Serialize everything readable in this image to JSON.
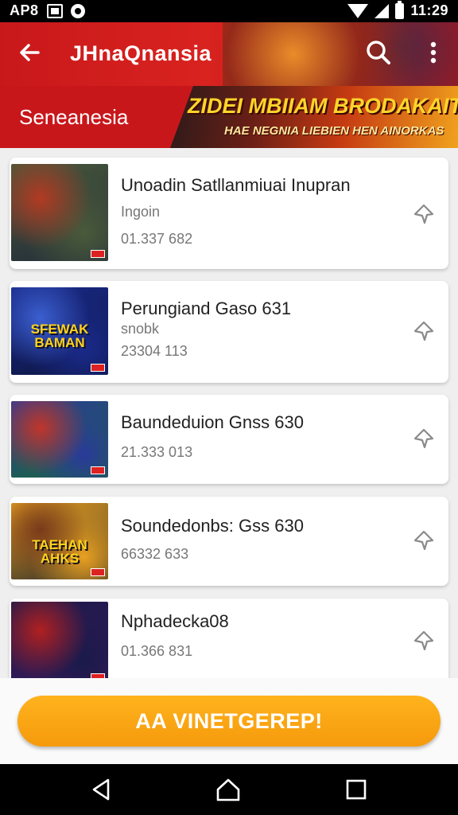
{
  "status_bar": {
    "carrier": "AP8",
    "time": "11:29"
  },
  "app_bar": {
    "title": "JHnaQnansia"
  },
  "banner": {
    "subtitle": "Seneanesia",
    "headline": "ZIDEI MBIIAM BRODAKAIT",
    "tagline": "HAE NEGNIA LIEBIEN HEN AINORKAS"
  },
  "items": [
    {
      "title": "Unoadin Satllanmiuai Inupran",
      "subtitle": "Ingoin",
      "stat": "01.337 682",
      "thumb_colors": [
        "#4a5a3a",
        "#b23a22",
        "#1f2a3a"
      ],
      "thumb_text": ""
    },
    {
      "title": "Perungiand Gaso 631",
      "subtitle": "snobk",
      "stat": "23304 113",
      "thumb_colors": [
        "#1a2a8a",
        "#3b5fd0",
        "#0d1540"
      ],
      "thumb_text": "SFEWAK BAMAN"
    },
    {
      "title": "Baundeduion Gnss 630",
      "subtitle": "",
      "stat": "21.333 013",
      "thumb_colors": [
        "#2a3a9a",
        "#c0352a",
        "#1a6a3a"
      ],
      "thumb_text": ""
    },
    {
      "title": "Soundedonbs: Gss 630",
      "subtitle": "",
      "stat": "66332 633",
      "thumb_colors": [
        "#e8a020",
        "#7a3a1a",
        "#2a2a2a"
      ],
      "thumb_text": "TAEHAN AHKS"
    },
    {
      "title": "Nphadecka08",
      "subtitle": "",
      "stat": "01.366 831",
      "thumb_colors": [
        "#1a1a4a",
        "#b02020",
        "#3a1a5a"
      ],
      "thumb_text": ""
    }
  ],
  "footer": {
    "cta_label": "AA VINETGEREP!"
  },
  "colors": {
    "primary": "#d01d1f",
    "cta": "#f7a20e",
    "headline": "#ffd42a"
  },
  "icons": {
    "back": "arrow-back-icon",
    "search": "search-icon",
    "menu": "more-vert-icon",
    "pin": "pin-icon",
    "nav_back": "nav-back-icon",
    "nav_home": "nav-home-icon",
    "nav_recents": "nav-recents-icon"
  }
}
